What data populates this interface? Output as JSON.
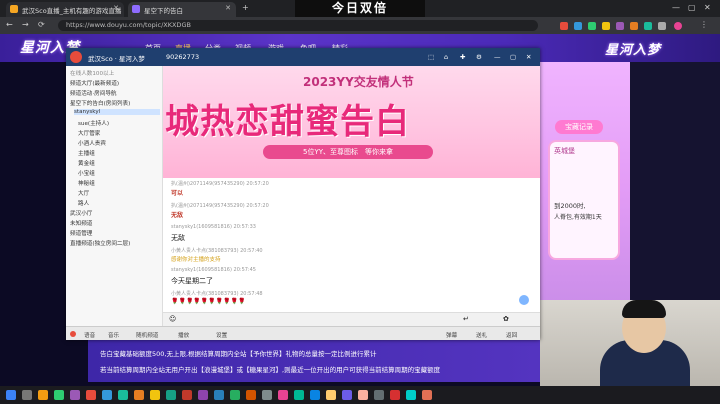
{
  "overlay_caption": "今日双倍",
  "browser": {
    "tabs": [
      {
        "label": "武汉Sco直播_主机有趣的游戏直播"
      },
      {
        "label": "星空下的告白"
      }
    ],
    "new_tab": "+",
    "url": "https://www.douyu.com/topic/XKXDGB",
    "nav_back": "←",
    "nav_forward": "→",
    "nav_reload": "⟳"
  },
  "site": {
    "brand": "星河入梦",
    "nav": [
      "首页",
      "直播",
      "分类",
      "视频",
      "游戏",
      "鱼吧",
      "精彩"
    ],
    "right_brand": "星河入梦"
  },
  "client": {
    "title_name": "武汉Sco · 星河入梦",
    "title_id": "90262773",
    "user_online_label": "在线人数100以上",
    "channel_tree": [
      "频道大厅(最新频道)",
      "频道活动·房间导航",
      "星空下的告白(房间列表)",
      "stanyskyl",
      "sue(主持人)",
      "大厅管家",
      "小酒人贵宾",
      "主播组",
      "黄金组",
      "小宝组",
      "神秘组",
      "大厅",
      "路人",
      "武汉小厅",
      "未知频道",
      "频道管理",
      "直播频道(独立房间二层)"
    ],
    "promo_title": "2023YY交友情人节",
    "promo_slogan": "城热恋甜蜜告白",
    "promo_sub": "5位YY、至尊图标　等你来拿",
    "messages": [
      {
        "meta": "扒(温州)2071149(957435290) 20:57:20",
        "text": "可以"
      },
      {
        "meta": "扒(温州)2071149(957435290) 20:57:20",
        "text": "无敌"
      },
      {
        "meta": "stanysky1(1609581816) 20:57:33",
        "text": "无敌"
      },
      {
        "meta": "小黄人贵人卡点(381083793) 20:57:40",
        "text": "感谢你对主播的支持"
      },
      {
        "meta": "stanysky1(1609581816) 20:57:45",
        "text": "今天星期二了"
      },
      {
        "meta": "小黄人贵人卡点(381083793) 20:57:48",
        "text": "🌹🌹🌹🌹🌹🌹🌹🌹🌹🌹"
      }
    ],
    "bottom_items": [
      "语音",
      "音乐",
      "麦序",
      "表情",
      "弹幕",
      "歌单",
      "送礼",
      "返回",
      "设置"
    ],
    "mic_btn": "随机频道",
    "mic_btn2": "播放"
  },
  "right_panel": {
    "title": "宝藏记录",
    "castle": "英城堡",
    "line1": "到2000时,",
    "line2": "人脊包,有效期1天"
  },
  "info_lines": [
    "告白宝藏基础额度500,无上限,根据结算周期内全站【予你世界】礼物的总量按一定比例进行累计",
    "若当前结算周期内全站无用户开出【浪漫城堡】或【糖果星河】,则最近一位开出的用户可获得当前结算周期的宝藏额度"
  ]
}
